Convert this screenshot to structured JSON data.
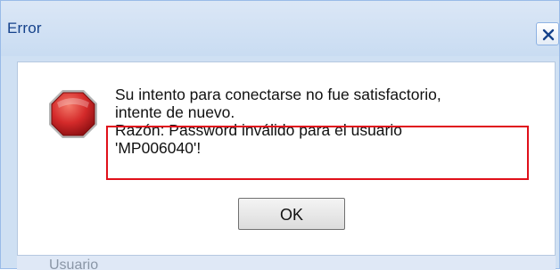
{
  "dialog": {
    "title": "Error",
    "message_lines": [
      "Su intento para conectarse no fue satisfactorio,",
      "intente de nuevo.",
      "Razón: Password inválido para el usuario",
      "'MP006040'!"
    ],
    "ok_label": "OK",
    "icon": "stop-icon",
    "close_icon": "close-icon"
  },
  "background": {
    "partial_label": "Usuario"
  },
  "colors": {
    "title_text": "#15428b",
    "highlight_border": "#e0101a",
    "stop_icon": "#d42a2a"
  }
}
